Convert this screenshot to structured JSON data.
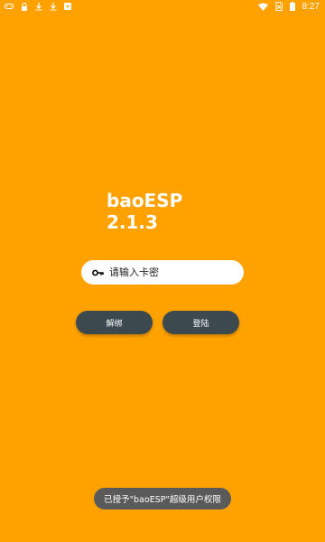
{
  "status_bar": {
    "left_icons": [
      "gamepad-icon",
      "lock-icon",
      "download-icon",
      "download-icon",
      "app-notification-icon"
    ],
    "right_icons": [
      "wifi-icon",
      "no-sim-icon",
      "battery-icon"
    ],
    "time": "8:27"
  },
  "app": {
    "name": "baoESP",
    "version": "2.1.3"
  },
  "key_input": {
    "icon": "key-icon",
    "placeholder": "请输入卡密",
    "value": ""
  },
  "buttons": {
    "unbind_label": "解绑",
    "login_label": "登陆"
  },
  "toast": {
    "message": "已授予\"baoESP\"超级用户权限"
  },
  "colors": {
    "background": "#FFA200",
    "button": "#3C4A50",
    "toast": "#5A5A5A"
  }
}
